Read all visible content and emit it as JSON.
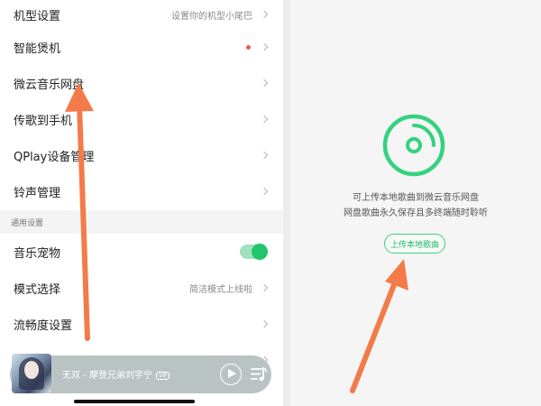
{
  "settings": {
    "rows": [
      {
        "label": "机型设置",
        "value": "设置你的机型小尾巴"
      },
      {
        "label": "智能煲机"
      },
      {
        "label": "微云音乐网盘"
      },
      {
        "label": "传歌到手机"
      },
      {
        "label": "QPlay设备管理"
      },
      {
        "label": "铃声管理"
      }
    ],
    "section_label": "通用设置",
    "general_rows": [
      {
        "label": "音乐宠物"
      },
      {
        "label": "模式选择",
        "value": "简洁模式上线啦"
      },
      {
        "label": "流畅度设置"
      }
    ]
  },
  "player": {
    "song": "无双 - 摩登兄弟刘宇宁",
    "badge": "VIP"
  },
  "cloud_disk": {
    "line1": "可上传本地歌曲到微云音乐网盘",
    "line2": "网盘歌曲永久保存且多终端随时聆听",
    "upload_label": "上传本地歌曲"
  },
  "colors": {
    "accent_green": "#22c56b",
    "annotation_arrow": "#f47a4a",
    "notification_dot": "#f05a5a"
  }
}
